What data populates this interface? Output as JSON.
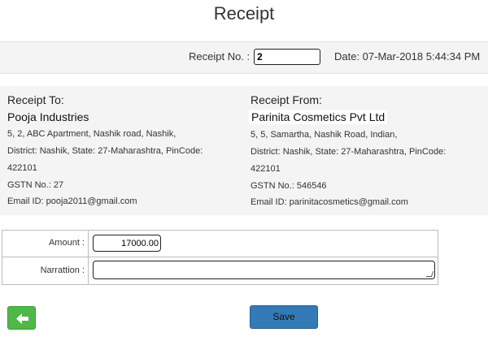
{
  "page_title": "Receipt",
  "receipt": {
    "no_label": "Receipt No. :",
    "no_value": "2",
    "date_text": "Date: 07-Mar-2018 5:44:34 PM"
  },
  "to": {
    "heading": "Receipt To:",
    "name": "Pooja Industries",
    "address_line1": "5, 2, ABC Apartment, Nashik road, Nashik,",
    "address_line2": "District: Nashik, State: 27-Maharashtra, PinCode:",
    "address_line3": "422101",
    "gstn": "GSTN No.: 27",
    "email": "Email ID: pooja2011@gmail.com"
  },
  "from": {
    "heading": "Receipt From:",
    "name": "Parinita Cosmetics Pvt Ltd",
    "address_line1": "5, 5, Samartha, Nashik Road, Indian,",
    "address_line2": "District: Nashik, State: 27-Maharashtra, PinCode:",
    "address_line3": "422101",
    "gstn": "GSTN No.: 546546",
    "email": "Email ID: parinitacosmetics@gmail.com"
  },
  "form": {
    "amount_label": "Amount :",
    "amount_value": "17000.00",
    "narration_label": "Narrattion :",
    "narration_value": ""
  },
  "actions": {
    "back_icon": "arrow-left-icon",
    "save_label": "Save"
  },
  "colors": {
    "save_button": "#337ab7",
    "back_button": "#4fb848",
    "panel_bg": "#f4f4f4"
  }
}
